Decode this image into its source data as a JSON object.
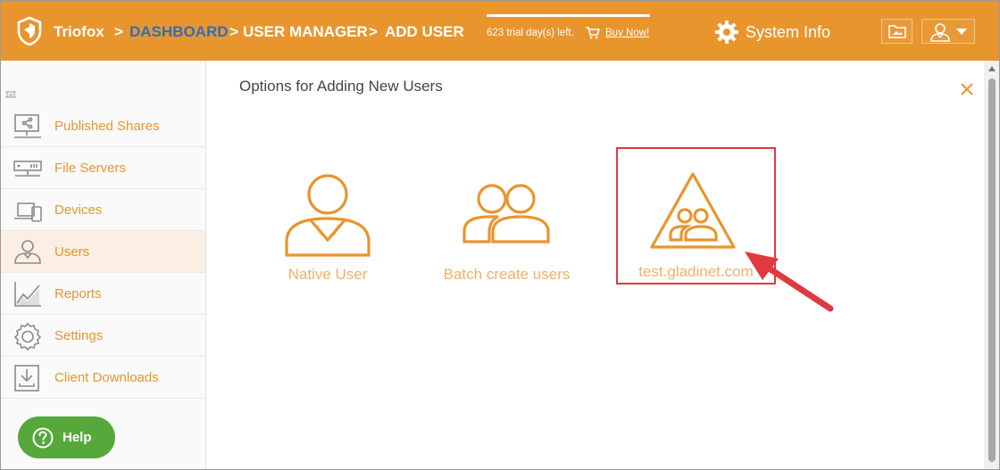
{
  "header": {
    "brand": "Triofox",
    "breadcrumb": [
      {
        "sep": ">",
        "label": "DASHBOARD"
      },
      {
        "sep": ">",
        "label": "USER MANAGER"
      },
      {
        "sep": ">",
        "label": "ADD USER"
      }
    ],
    "trial_text": "623 trial day(s) left.",
    "buy_now": "Buy Now!",
    "system_info": "System Info",
    "icons": [
      "shield-logo-icon",
      "cart-icon",
      "gear-icon",
      "folder-icon",
      "user-icon",
      "caret-down-icon"
    ]
  },
  "sidebar": {
    "items": [
      {
        "label": "Published Shares",
        "icon": "shared-folder-icon"
      },
      {
        "label": "File Servers",
        "icon": "server-icon"
      },
      {
        "label": "Devices",
        "icon": "devices-icon"
      },
      {
        "label": "Users",
        "icon": "user-icon",
        "selected": true
      },
      {
        "label": "Reports",
        "icon": "chart-icon"
      },
      {
        "label": "Settings",
        "icon": "gear-icon"
      },
      {
        "label": "Client Downloads",
        "icon": "download-icon"
      }
    ],
    "help_label": "Help"
  },
  "main": {
    "title": "Options for Adding New Users",
    "options": [
      {
        "label": "Native User",
        "icon": "native-user-icon"
      },
      {
        "label": "Batch create users",
        "icon": "batch-users-icon"
      },
      {
        "label": "test.gladinet.com",
        "icon": "domain-users-icon"
      }
    ]
  },
  "colors": {
    "accent": "#e8952e",
    "breadcrumb_active": "#2f6fb7",
    "option_icon": "#e8952e",
    "option_label": "#efb06a",
    "highlight": "#e0393e",
    "help_bg": "#57a83a"
  }
}
